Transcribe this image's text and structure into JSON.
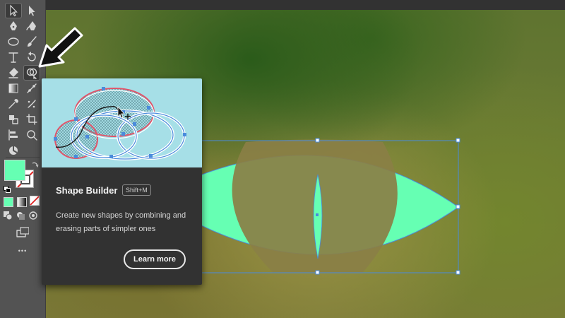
{
  "toolbar": {
    "tools": [
      {
        "name": "selection-tool",
        "icon": "selection-arrow-icon"
      },
      {
        "name": "direct-selection-tool",
        "icon": "direct-selection-icon"
      },
      {
        "name": "pen-tool",
        "icon": "pen-icon"
      },
      {
        "name": "curvature-tool",
        "icon": "curvature-pen-icon"
      },
      {
        "name": "ellipse-tool",
        "icon": "ellipse-icon"
      },
      {
        "name": "paintbrush-tool",
        "icon": "paintbrush-icon"
      },
      {
        "name": "type-tool",
        "icon": "type-icon",
        "glyph": "T"
      },
      {
        "name": "rotate-tool",
        "icon": "rotate-icon"
      },
      {
        "name": "eraser-tool",
        "icon": "eraser-icon"
      },
      {
        "name": "shape-builder-tool",
        "icon": "shape-builder-icon",
        "selected": true
      },
      {
        "name": "gradient-tool",
        "icon": "gradient-icon"
      },
      {
        "name": "puppet-warp-tool",
        "icon": "puppet-warp-icon"
      },
      {
        "name": "eyedropper-tool",
        "icon": "eyedropper-icon"
      },
      {
        "name": "symbol-sprayer-tool",
        "icon": "symbol-sprayer-icon"
      },
      {
        "name": "shaper-tool",
        "icon": "shaper-icon"
      },
      {
        "name": "artboard-tool",
        "icon": "artboard-icon"
      },
      {
        "name": "column-graph-tool",
        "icon": "column-graph-icon"
      },
      {
        "name": "zoom-tool",
        "icon": "zoom-icon"
      },
      {
        "name": "hand-tool",
        "icon": "hand-icon"
      }
    ],
    "fill_color": "#66ffb3",
    "stroke_color": "none",
    "more_tools_glyph": "•••"
  },
  "tooltip": {
    "title": "Shape Builder",
    "shortcut": "Shift+M",
    "description": "Create new shapes by combining and erasing parts of simpler ones",
    "learn_more": "Learn more"
  },
  "artwork": {
    "shape": "eye",
    "fill_color": "#66ffb3",
    "selection_color": "#4a8bdc"
  }
}
